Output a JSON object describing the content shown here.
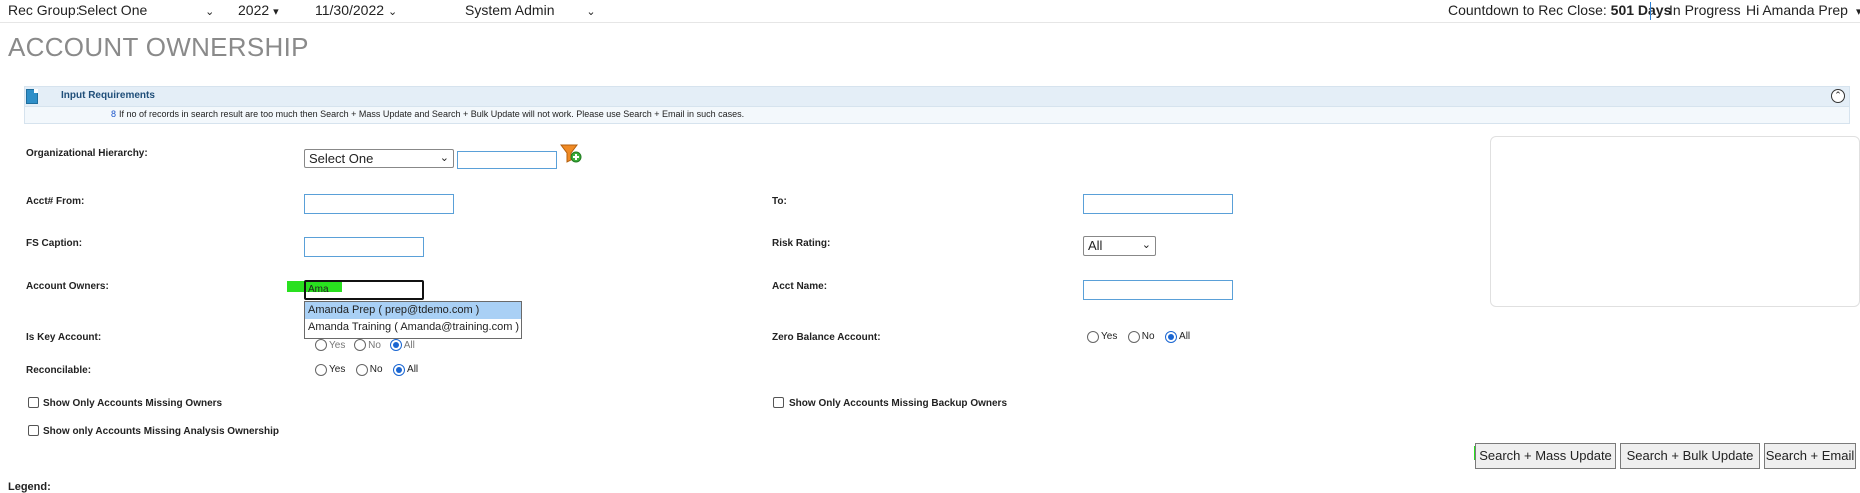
{
  "topbar": {
    "rec_group_label": "Rec Group:",
    "rec_group_value": "Select One",
    "year": "2022",
    "date": "11/30/2022",
    "role": "System Admin",
    "countdown_label": "Countdown to Rec Close:",
    "countdown_value": "501 Days",
    "status": "In Progress",
    "greeting": "Hi Amanda Prep"
  },
  "page_title": "ACCOUNT OWNERSHIP",
  "input_requirements": {
    "title": "Input Requirements",
    "note_number": "8",
    "note": "If no of records in search result are too much then Search + Mass Update and Search + Bulk Update will not work. Please use Search + Email in such cases."
  },
  "form": {
    "org_hierarchy_label": "Organizational Hierarchy:",
    "org_hierarchy_value": "Select One",
    "acct_from_label": "Acct# From:",
    "to_label": "To:",
    "fs_caption_label": "FS Caption:",
    "risk_rating_label": "Risk Rating:",
    "risk_rating_value": "All",
    "account_owners_label": "Account Owners:",
    "account_owners_value": "Ama",
    "acct_name_label": "Acct Name:",
    "is_key_label": "Is Key Account:",
    "zero_balance_label": "Zero Balance Account:",
    "reconcilable_label": "Reconcilable:",
    "radio_yes": "Yes",
    "radio_no": "No",
    "radio_all": "All",
    "is_key_selected": "All",
    "zero_balance_selected": "All",
    "reconcilable_selected": "All",
    "missing_owners_label": "Show Only Accounts Missing Owners",
    "missing_backup_label": "Show Only Accounts Missing Backup Owners",
    "missing_analysis_label": "Show only Accounts Missing Analysis Ownership"
  },
  "autocomplete": [
    "Amanda Prep ( prep@tdemo.com )",
    "Amanda Training ( Amanda@training.com )"
  ],
  "buttons": {
    "mass_update": "Search + Mass Update",
    "bulk_update": "Search + Bulk Update",
    "email": "Search + Email"
  },
  "legend_label": "Legend:",
  "colors": {
    "highlight": "#29e01f",
    "title_gray": "#8a8a8a",
    "panel_blue": "#e4eef7"
  }
}
